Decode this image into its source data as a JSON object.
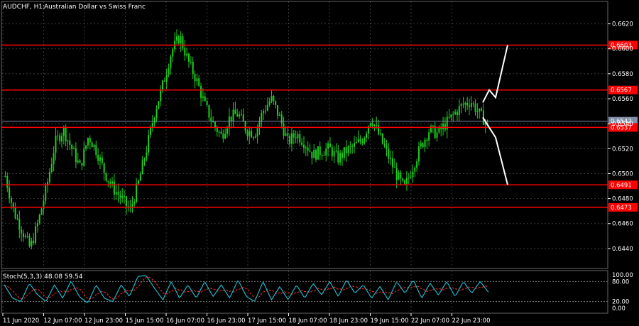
{
  "header": {
    "symbol_timeframe": "AUDCHF, H1:",
    "description": "Australian Dollar vs Swiss Franc"
  },
  "indicator": {
    "label": "Stoch(5,3,3) 48.08 59.54",
    "levels": [
      "100.00",
      "80.00",
      "20.00",
      "0.00"
    ],
    "main_color": "#1fb5c8",
    "signal_color": "#ff3030"
  },
  "colors": {
    "background": "#000000",
    "grid": "#3a3a3a",
    "candle": "#22cc22",
    "resistance": "#ff0000",
    "bid_line": "#7f8fa8",
    "arrow": "#ffffff"
  },
  "chart_data": {
    "type": "candlestick",
    "price_axis_ticks": [
      "0.6620",
      "0.6600",
      "0.6580",
      "0.6560",
      "0.6540",
      "0.6520",
      "0.6500",
      "0.6480",
      "0.6460",
      "0.6440"
    ],
    "ylim": [
      0.6424,
      0.663
    ],
    "time_axis_ticks": [
      "11 Jun 2020",
      "12 Jun 07:00",
      "12 Jun 23:00",
      "15 Jun 15:00",
      "16 Jun 07:00",
      "16 Jun 23:00",
      "17 Jun 15:00",
      "18 Jun 07:00",
      "18 Jun 23:00",
      "19 Jun 15:00",
      "22 Jun 07:00",
      "22 Jun 23:00"
    ],
    "current_price": "0.6542",
    "horizontal_levels": [
      {
        "value": 0.6603,
        "label": "0.6603"
      },
      {
        "value": 0.6567,
        "label": "0.6567"
      },
      {
        "value": 0.6537,
        "label": "0.6537"
      },
      {
        "value": 0.6491,
        "label": "0.6491"
      },
      {
        "value": 0.6473,
        "label": "0.6473"
      }
    ],
    "close_anchors": [
      0.6498,
      0.647,
      0.6455,
      0.644,
      0.6462,
      0.649,
      0.6525,
      0.6535,
      0.652,
      0.6505,
      0.653,
      0.6518,
      0.65,
      0.6488,
      0.648,
      0.647,
      0.6492,
      0.652,
      0.655,
      0.6572,
      0.6598,
      0.661,
      0.659,
      0.6575,
      0.6555,
      0.654,
      0.653,
      0.6545,
      0.6548,
      0.6535,
      0.6532,
      0.655,
      0.656,
      0.6545,
      0.6525,
      0.6532,
      0.6525,
      0.6515,
      0.6518,
      0.652,
      0.6512,
      0.6518,
      0.6522,
      0.6528,
      0.6545,
      0.653,
      0.6515,
      0.65,
      0.6488,
      0.6505,
      0.6522,
      0.6535,
      0.6532,
      0.654,
      0.6548,
      0.6555,
      0.6558,
      0.6548,
      0.654
    ],
    "bullish_projection": [
      0.6557,
      0.6567,
      0.6561,
      0.6603
    ],
    "bearish_projection": [
      0.6545,
      0.6537,
      0.6529,
      0.6491
    ],
    "stoch_anchors": [
      70,
      30,
      20,
      75,
      40,
      20,
      70,
      30,
      82,
      35,
      15,
      70,
      30,
      20,
      70,
      35,
      95,
      98,
      60,
      25,
      80,
      30,
      70,
      30,
      80,
      35,
      70,
      30,
      85,
      35,
      20,
      80,
      25,
      65,
      25,
      70,
      30,
      75,
      40,
      80,
      35,
      85,
      45,
      70,
      30,
      65,
      25,
      80,
      45,
      85,
      30,
      75,
      40,
      80,
      35,
      80,
      45,
      80,
      48
    ]
  }
}
